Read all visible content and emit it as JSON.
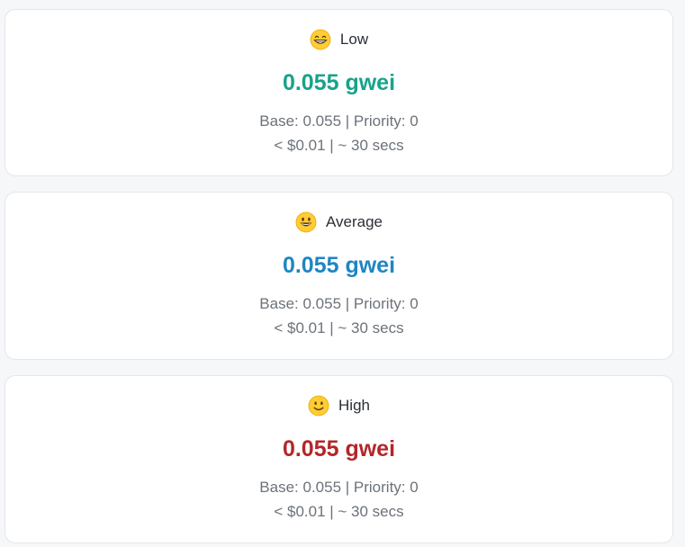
{
  "tiers": [
    {
      "label": "Low",
      "icon": "grinning-face-with-smiling-eyes-icon",
      "price": "0.055 gwei",
      "price_color": "#17a38b",
      "base_priority": "Base: 0.055 | Priority: 0",
      "cost_time": "< $0.01 | ~ 30 secs"
    },
    {
      "label": "Average",
      "icon": "grinning-face-icon",
      "price": "0.055 gwei",
      "price_color": "#1f86c3",
      "base_priority": "Base: 0.055 | Priority: 0",
      "cost_time": "< $0.01 | ~ 30 secs"
    },
    {
      "label": "High",
      "icon": "slightly-smiling-face-icon",
      "price": "0.055 gwei",
      "price_color": "#b3262a",
      "base_priority": "Base: 0.055 | Priority: 0",
      "cost_time": "< $0.01 | ~ 30 secs"
    }
  ]
}
